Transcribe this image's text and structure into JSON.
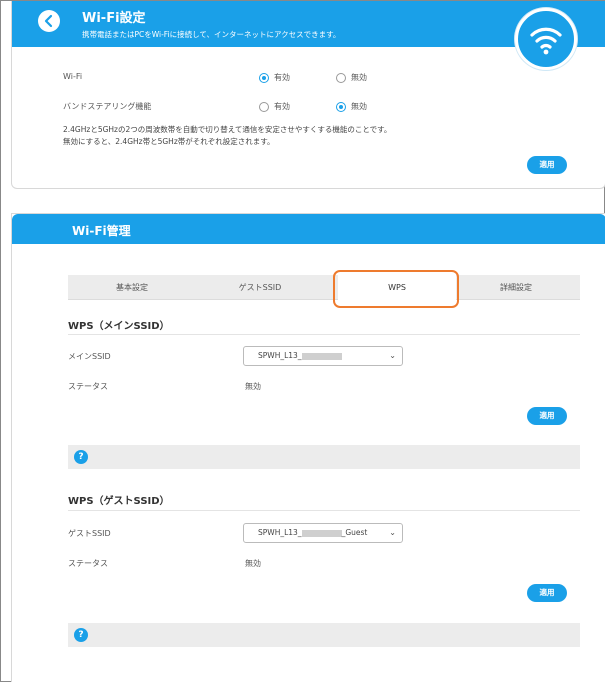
{
  "wifi_settings": {
    "title": "Wi-Fi設定",
    "subtitle": "携帯電話またはPCをWi-Fiに接続して、インターネットにアクセスできます。",
    "back_icon": "chevron-left-icon",
    "badge_icon": "wifi-icon",
    "wifi_label": "Wi-Fi",
    "wifi_enabled_label": "有効",
    "wifi_disabled_label": "無効",
    "wifi_selected": "有効",
    "band_steering_label": "バンドステアリング機能",
    "band_enabled_label": "有効",
    "band_disabled_label": "無効",
    "band_selected": "無効",
    "description_line1": "2.4GHzと5GHzの2つの周波数帯を自動で切り替えて通信を安定させやすくする機能のことです。",
    "description_line2": "無効にすると、2.4GHz帯と5GHz帯がそれぞれ設定されます。",
    "apply_label": "適用"
  },
  "wifi_management": {
    "title": "Wi-Fi管理",
    "tabs": [
      {
        "label": "基本設定"
      },
      {
        "label": "ゲストSSID"
      },
      {
        "label": "WPS"
      },
      {
        "label": "詳細設定"
      }
    ],
    "active_tab": "WPS",
    "highlight_color": "#ee7b2e",
    "main_section": {
      "title": "WPS（メインSSID）",
      "ssid_label": "メインSSID",
      "ssid_value": "SPWH_L13_",
      "status_label": "ステータス",
      "status_value": "無効",
      "apply_label": "適用"
    },
    "guest_section": {
      "title": "WPS（ゲストSSID）",
      "ssid_label": "ゲストSSID",
      "ssid_value_prefix": "SPWH_L13_",
      "ssid_value_suffix": "_Guest",
      "status_label": "ステータス",
      "status_value": "無効",
      "apply_label": "適用"
    },
    "help_icon_glyph": "?"
  },
  "colors": {
    "accent": "#1aa0e8"
  }
}
